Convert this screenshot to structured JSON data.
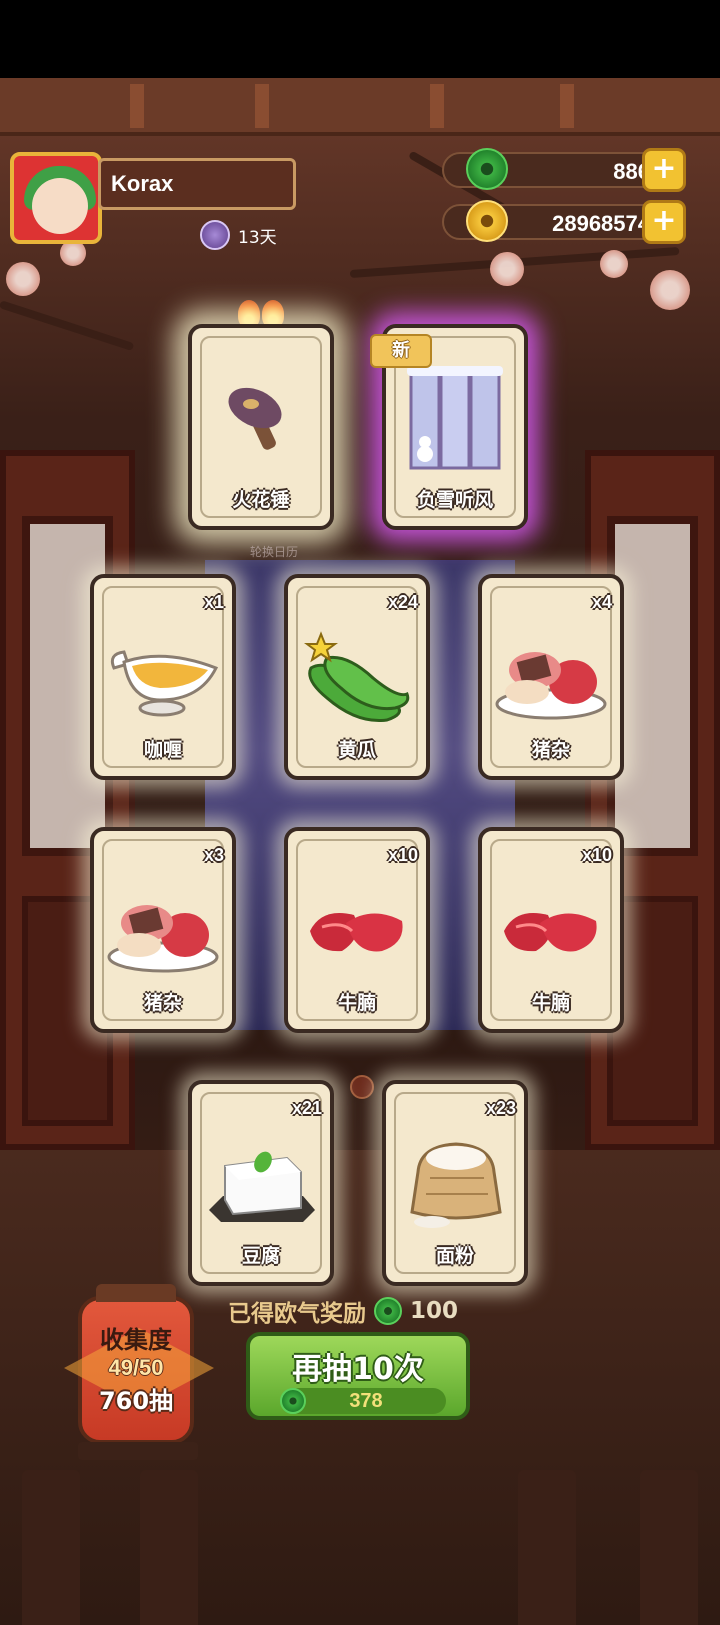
{
  "player": {
    "name": "Korax",
    "days": "13天"
  },
  "currency": {
    "jade": "886",
    "coins": "28968574",
    "add_symbol": "+"
  },
  "featured": [
    {
      "name": "火花锤",
      "rarity": "gold",
      "icon": "hammer-icon"
    },
    {
      "name": "负雪听风",
      "rarity": "purple",
      "tag": "新",
      "icon": "snow-screen-icon"
    }
  ],
  "calendar_hint": "轮换日历",
  "cards": [
    {
      "name": "咖喱",
      "count": "x1",
      "icon": "curry-gravy-boat-icon"
    },
    {
      "name": "黄瓜",
      "count": "x24",
      "icon": "cucumber-icon"
    },
    {
      "name": "猪杂",
      "count": "x4",
      "icon": "pork-offal-icon"
    },
    {
      "name": "猪杂",
      "count": "x3",
      "icon": "pork-offal-icon"
    },
    {
      "name": "牛腩",
      "count": "x10",
      "icon": "beef-brisket-icon"
    },
    {
      "name": "牛腩",
      "count": "x10",
      "icon": "beef-brisket-icon"
    },
    {
      "name": "豆腐",
      "count": "x21",
      "icon": "tofu-icon"
    },
    {
      "name": "面粉",
      "count": "x23",
      "icon": "flour-sack-icon"
    }
  ],
  "reward": {
    "label": "已得欧气奖励",
    "amount": "100"
  },
  "draw_button": {
    "label": "再抽10次",
    "cost": "378"
  },
  "collection": {
    "title": "收集度",
    "progress": "49/50",
    "draws": "760抽"
  },
  "colors": {
    "purple_glow": "#d65af0",
    "button_green": "#5ba72c",
    "jade_green": "#3cb042",
    "coin_gold": "#f6c73c"
  }
}
